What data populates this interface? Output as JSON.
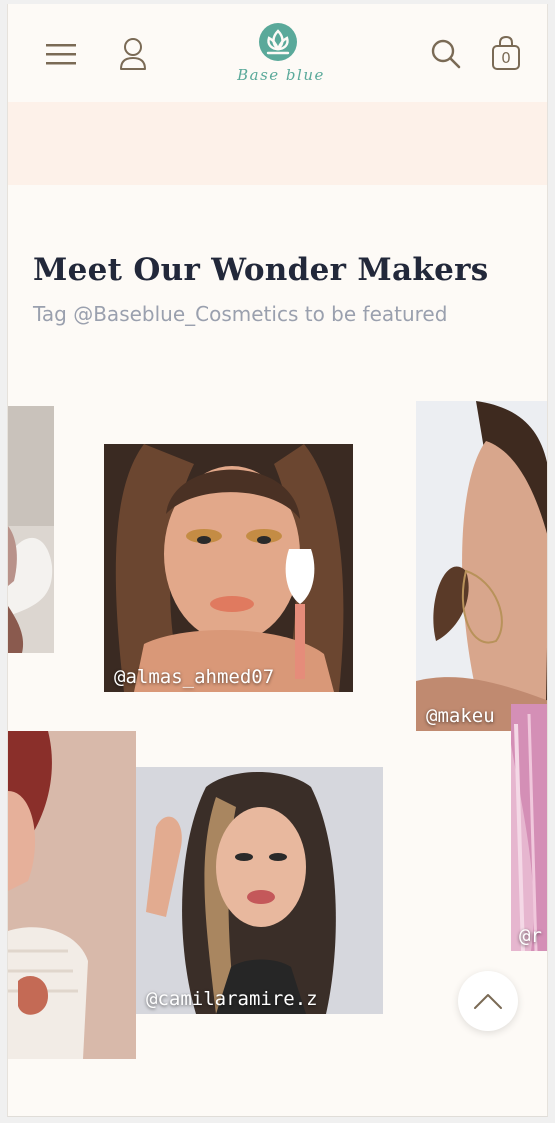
{
  "header": {
    "logo_text": "Base blue",
    "cart_count": "0",
    "brand_color": "#5aa99a",
    "icon_color": "#7a6a55"
  },
  "section": {
    "title": "Meet Our Wonder Makers",
    "subtitle": "Tag @Baseblue_Cosmetics to be featured"
  },
  "gallery": {
    "cards": [
      {
        "handle": "",
        "photo": "woman holding white sculpture, cropped"
      },
      {
        "handle": "@almas_ahmed07",
        "photo": "woman with gold eye makeup holding white lipstick"
      },
      {
        "handle": "@makeu",
        "photo": "woman with hoop earring, profile"
      },
      {
        "handle": "",
        "photo": "woman with red hair, lace top, holding glass"
      },
      {
        "handle": "@camilaramire.z",
        "photo": "woman with long dark highlighted hair"
      },
      {
        "handle": "@r",
        "photo": "pink hair, cropped"
      }
    ]
  },
  "controls": {
    "scroll_top_icon": "chevron-up-icon"
  }
}
